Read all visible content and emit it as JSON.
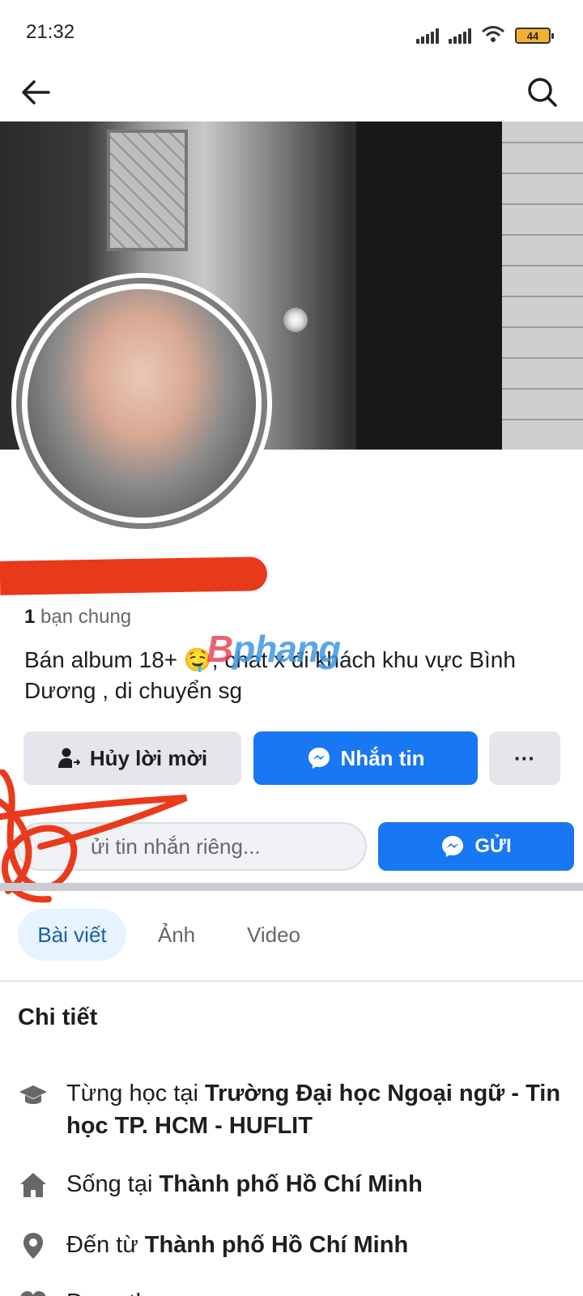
{
  "status_bar": {
    "time": "21:32",
    "battery": "44"
  },
  "nav": {
    "back_icon": "arrow-left-icon",
    "search_icon": "search-icon"
  },
  "profile": {
    "mutual_count": "1",
    "mutual_label": "bạn chung",
    "bio": "Bán album 18+ 🤤, chat x đi khách khu vực Bình Dương , di chuyển sg",
    "watermark_first": "B",
    "watermark_rest": "phang"
  },
  "actions": {
    "cancel_request": "Hủy lời mời",
    "message": "Nhắn tin",
    "more": "···"
  },
  "private_message": {
    "placeholder": "Gửi tin nhắn riêng...",
    "visible_text": "ửi tin nhắn riêng...",
    "send": "GỬI"
  },
  "tabs": [
    {
      "label": "Bài viết",
      "active": true
    },
    {
      "label": "Ảnh",
      "active": false
    },
    {
      "label": "Video",
      "active": false
    }
  ],
  "details": {
    "title": "Chi tiết",
    "education": {
      "prefix": "Từng học tại ",
      "value": "Trường Đại học Ngoại ngữ - Tin học TP. HCM - HUFLIT",
      "icon": "graduation-cap-icon"
    },
    "lives": {
      "prefix": "Sống tại ",
      "value": "Thành phố Hồ Chí Minh",
      "icon": "home-icon"
    },
    "from": {
      "prefix": "Đến từ ",
      "value": "Thành phố Hồ Chí Minh",
      "icon": "location-pin-icon"
    },
    "more": {
      "prefix": "Đang thu...",
      "icon": "heart-icon"
    }
  },
  "colors": {
    "primary": "#1877f2",
    "secondary_button": "#e4e6eb",
    "active_tab_bg": "#e7f3ff",
    "active_tab_text": "#1b5fa8",
    "redaction": "#e8391b"
  }
}
